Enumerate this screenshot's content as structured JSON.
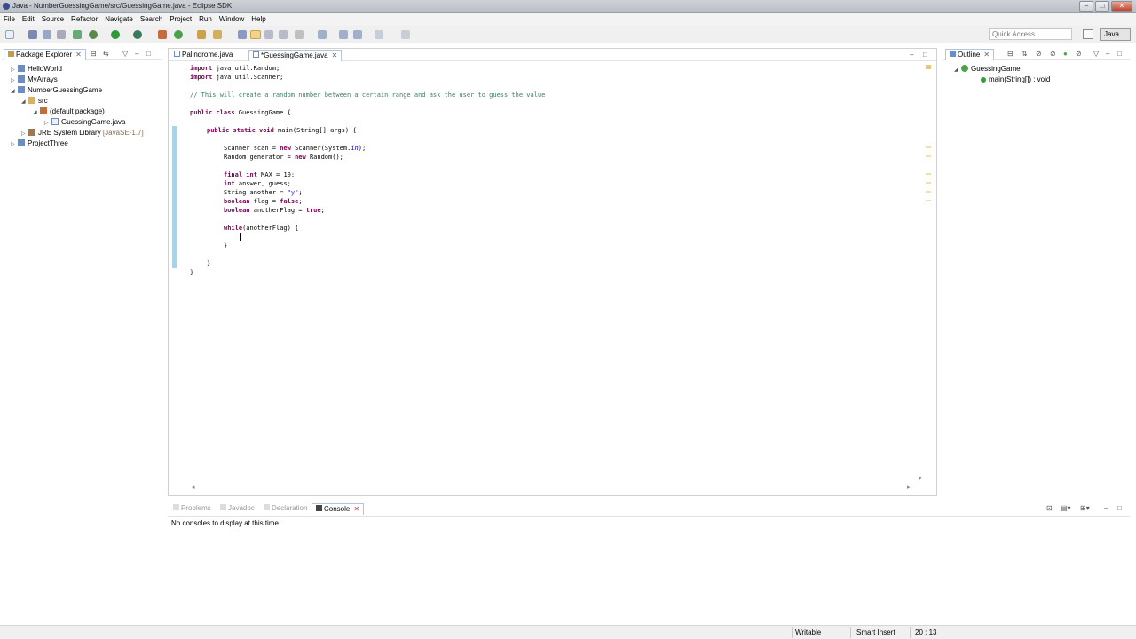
{
  "window": {
    "title": "Java - NumberGuessingGame/src/GuessingGame.java - Eclipse SDK"
  },
  "menu": [
    "File",
    "Edit",
    "Source",
    "Refactor",
    "Navigate",
    "Search",
    "Project",
    "Run",
    "Window",
    "Help"
  ],
  "toolbar": {
    "quick_access_placeholder": "Quick Access",
    "perspective": "Java"
  },
  "package_explorer": {
    "title": "Package Explorer",
    "items": [
      {
        "label": "HelloWorld",
        "type": "project"
      },
      {
        "label": "MyArrays",
        "type": "project"
      },
      {
        "label": "NumberGuessingGame",
        "type": "project"
      },
      {
        "label": "src",
        "type": "folder"
      },
      {
        "label": "(default package)",
        "type": "package"
      },
      {
        "label": "GuessingGame.java",
        "type": "file"
      },
      {
        "label": "JRE System Library",
        "suffix": "[JavaSE-1.7]",
        "type": "library"
      },
      {
        "label": "ProjectThree",
        "type": "project"
      }
    ]
  },
  "editor": {
    "tabs": [
      {
        "label": "Palindrome.java"
      },
      {
        "label": "*GuessingGame.java"
      }
    ],
    "lines": {
      "l1a": "import",
      "l1b": " java.util.Random;",
      "l2a": "import",
      "l2b": " java.util.Scanner;",
      "l4": "// This will create a random number between a certain range and ask the user to guess the value",
      "l6a": "public class",
      "l6b": " GuessingGame {",
      "l8a": "public static void",
      "l8b": " main(String[] args) {",
      "l10": "Scanner scan = ",
      "l10k": "new",
      "l10c": " Scanner(System.",
      "l10f": "in",
      "l10d": ");",
      "l11": "Random generator = ",
      "l11k": "new",
      "l11c": " Random();",
      "l13k": "final int",
      "l13c": " MAX = 10;",
      "l14k": "int",
      "l14c": " answer, guess;",
      "l15": "String another = ",
      "l15s": "\"y\"",
      "l15c": ";",
      "l16k": "boolean",
      "l16c": " flag = ",
      "l16k2": "false",
      "l16d": ";",
      "l17k": "boolean",
      "l17c": " anotherFlag = ",
      "l17k2": "true",
      "l17d": ";",
      "l19k": "while",
      "l19c": "(anotherFlag) {",
      "l21": "}",
      "l23": "}",
      "l24": "}"
    }
  },
  "outline": {
    "title": "Outline",
    "items": [
      {
        "label": "GuessingGame"
      },
      {
        "label": "main(String[]) : void"
      }
    ]
  },
  "console": {
    "tabs": [
      "Problems",
      "Javadoc",
      "Declaration",
      "Console"
    ],
    "message": "No consoles to display at this time."
  },
  "status": {
    "writable": "Writable",
    "insert_mode": "Smart Insert",
    "position": "20 : 13"
  },
  "colors": {
    "keyword": "#7f0055",
    "comment": "#3f7f5f",
    "string": "#2a00ff",
    "field": "#0000c0",
    "gutter_change": "#a8d4e6"
  }
}
